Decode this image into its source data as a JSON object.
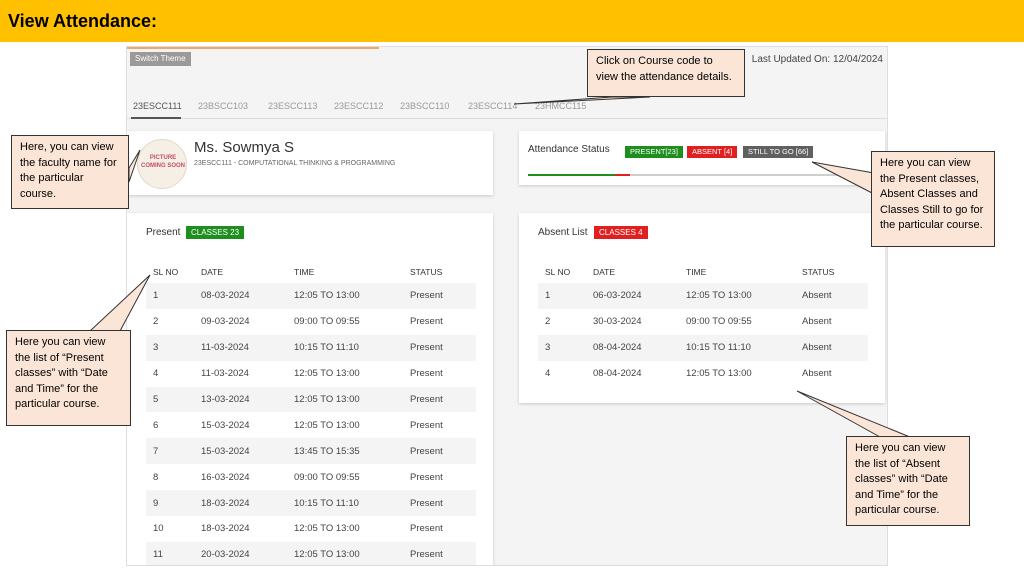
{
  "page": {
    "title": "View Attendance:"
  },
  "app": {
    "switch_theme": "Switch Theme",
    "last_updated": "Last Updated On: 12/04/2024",
    "tabs": [
      "23ESCC111",
      "23BSCC103",
      "23ESCC113",
      "23ESCC112",
      "23BSCC110",
      "23ESCC114",
      "23HMCC115"
    ],
    "active_tab": 0
  },
  "faculty": {
    "avatar_text": "PICTURE COMING SOON",
    "name": "Ms. Sowmya S",
    "course": "23ESCC111 - COMPUTATIONAL THINKING & PROGRAMMING"
  },
  "status": {
    "label": "Attendance Status",
    "present_badge": "PRESENT[23]",
    "absent_badge": "ABSENT [4]",
    "togo_badge": "STILL TO GO [66]",
    "present_count": 23,
    "absent_count": 4,
    "togo_count": 66,
    "colors": {
      "present": "#1e8e1e",
      "absent": "#e02020",
      "togo": "#606060"
    }
  },
  "present": {
    "title": "Present",
    "badge": "CLASSES 23",
    "columns": [
      "SL NO",
      "DATE",
      "TIME",
      "STATUS"
    ],
    "rows": [
      [
        "1",
        "08-03-2024",
        "12:05 TO 13:00",
        "Present"
      ],
      [
        "2",
        "09-03-2024",
        "09:00 TO 09:55",
        "Present"
      ],
      [
        "3",
        "11-03-2024",
        "10:15 TO 11:10",
        "Present"
      ],
      [
        "4",
        "11-03-2024",
        "12:05 TO 13:00",
        "Present"
      ],
      [
        "5",
        "13-03-2024",
        "12:05 TO 13:00",
        "Present"
      ],
      [
        "6",
        "15-03-2024",
        "12:05 TO 13:00",
        "Present"
      ],
      [
        "7",
        "15-03-2024",
        "13:45 TO 15:35",
        "Present"
      ],
      [
        "8",
        "16-03-2024",
        "09:00 TO 09:55",
        "Present"
      ],
      [
        "9",
        "18-03-2024",
        "10:15 TO 11:10",
        "Present"
      ],
      [
        "10",
        "18-03-2024",
        "12:05 TO 13:00",
        "Present"
      ],
      [
        "11",
        "20-03-2024",
        "12:05 TO 13:00",
        "Present"
      ]
    ]
  },
  "absent": {
    "title": "Absent List",
    "badge": "CLASSES 4",
    "columns": [
      "SL NO",
      "DATE",
      "TIME",
      "STATUS"
    ],
    "rows": [
      [
        "1",
        "06-03-2024",
        "12:05 TO 13:00",
        "Absent"
      ],
      [
        "2",
        "30-03-2024",
        "09:00 TO 09:55",
        "Absent"
      ],
      [
        "3",
        "08-04-2024",
        "10:15 TO 11:10",
        "Absent"
      ],
      [
        "4",
        "08-04-2024",
        "12:05 TO 13:00",
        "Absent"
      ]
    ]
  },
  "callouts": {
    "course_code": "Click on Course code to view the attendance details.",
    "faculty": "Here, you can view the faculty name for the particular course.",
    "status": "Here you can view the Present classes, Absent Classes and Classes Still to go for the particular course.",
    "present_list": "Here you can view the list of “Present classes” with “Date and Time” for the particular course.",
    "absent_list": "Here you can view the list of “Absent classes” with “Date and Time” for the particular course."
  }
}
